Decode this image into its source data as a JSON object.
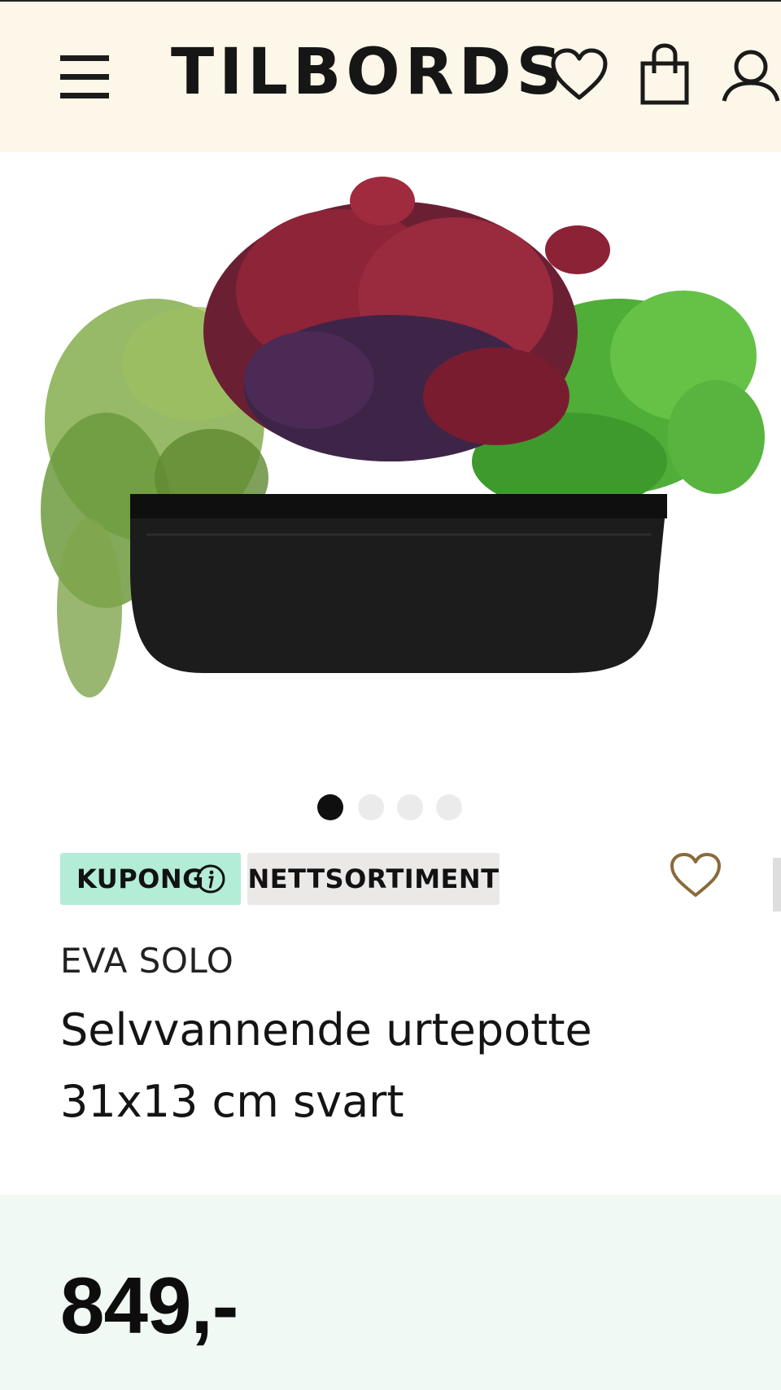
{
  "header": {
    "logo": "TILBORDS",
    "menu_icon": "hamburger-menu-icon",
    "wishlist_icon": "heart-icon",
    "cart_icon": "shopping-bag-icon",
    "account_icon": "user-icon"
  },
  "gallery": {
    "image_description_icon": "product-photo",
    "slides_total": 4,
    "active_slide": 1
  },
  "badges": {
    "coupon_label": "KUPONG",
    "coupon_info_icon": "info-icon",
    "online_only_label": "NETTSORTIMENT"
  },
  "product": {
    "brand": "EVA SOLO",
    "title": "Selvvannende urtepotte 31x13 cm svart",
    "price": "849,-",
    "favorite_icon": "heart-outline-icon"
  },
  "colors": {
    "header_bg": "#fcf7e8",
    "coupon_badge_bg": "#b3ecd7",
    "online_badge_bg": "#ebe8e8",
    "price_panel_bg": "#f1f9f4",
    "favorite_heart": "#8a6a3a"
  }
}
